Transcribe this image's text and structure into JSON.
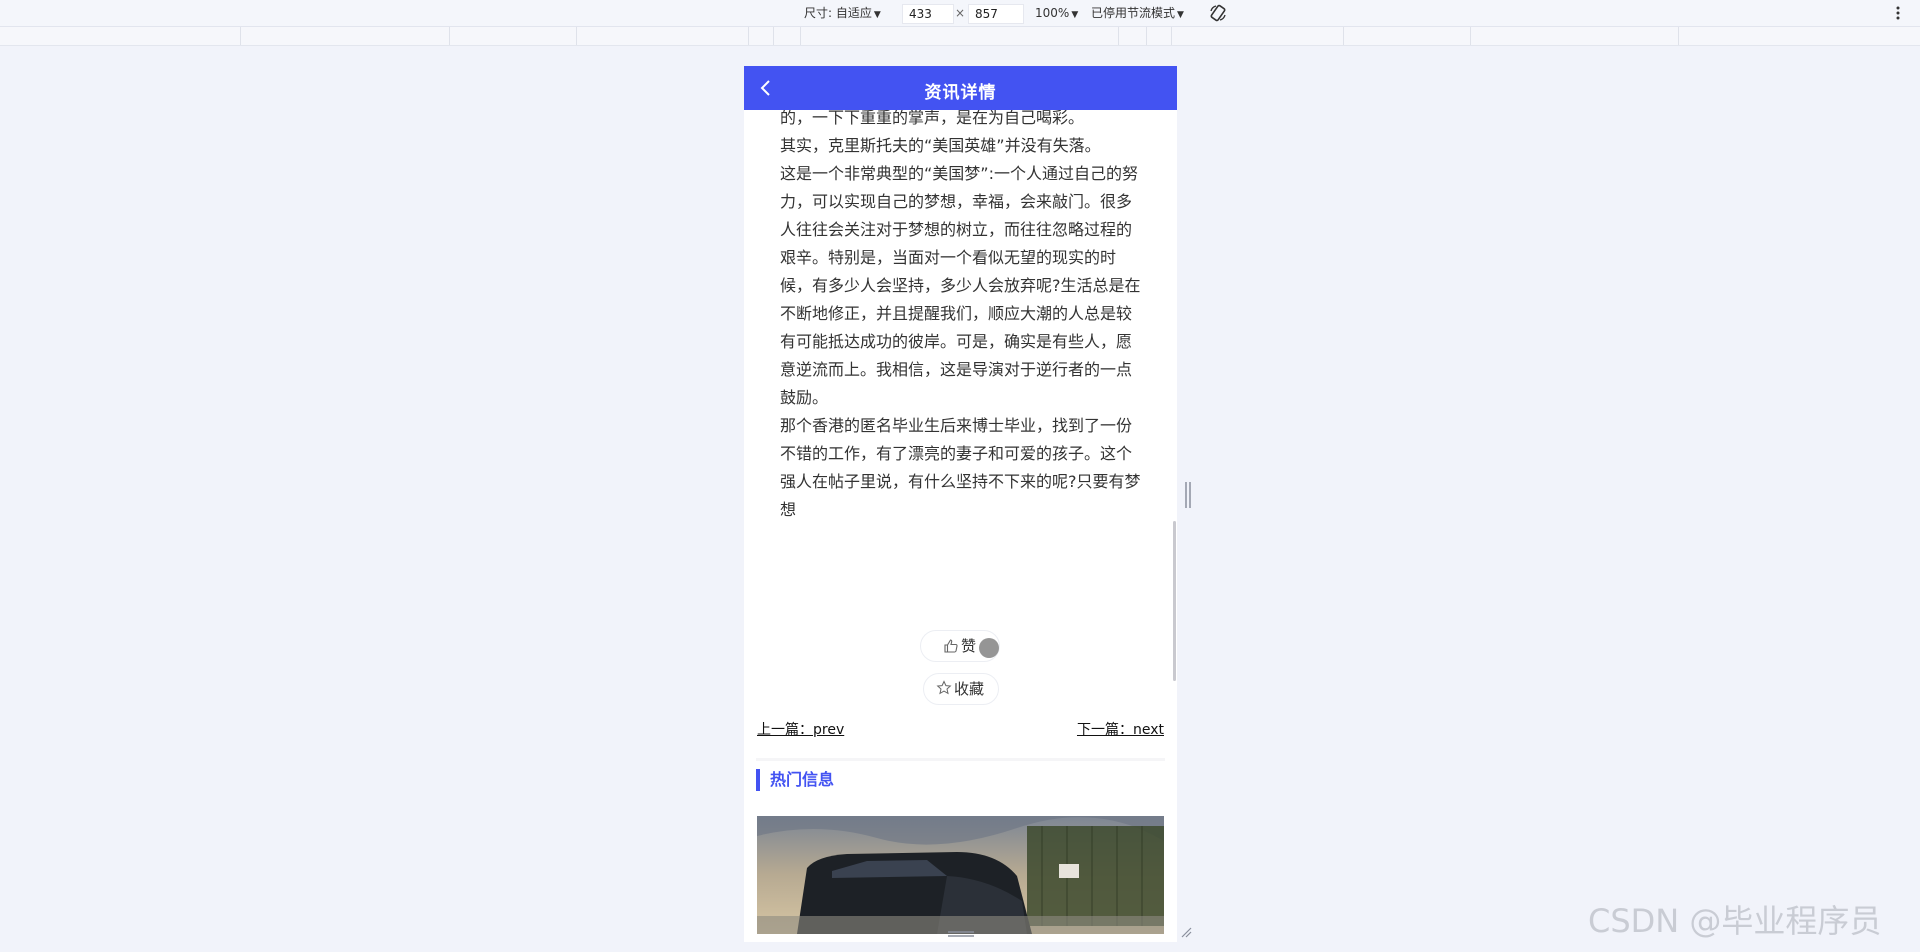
{
  "devtools": {
    "size_label": "尺寸: 自适应",
    "width_value": "433",
    "times": "×",
    "height_value": "857",
    "zoom": "100%",
    "throttle": "已停用节流模式"
  },
  "page": {
    "title": "资讯详情",
    "article_paragraphs": [
      "的，一下下重重的掌声，是在为自己喝彩。",
      "其实，克里斯托夫的“美国英雄”并没有失落。",
      "这是一个非常典型的“美国梦”:一个人通过自己的努力，可以实现自己的梦想，幸福，会来敲门。很多人往往会关注对于梦想的树立，而往往忽略过程的艰辛。特别是，当面对一个看似无望的现实的时候，有多少人会坚持，多少人会放弃呢?生活总是在不断地修正，并且提醒我们，顺应大潮的人总是较有可能抵达成功的彼岸。可是，确实是有些人，愿意逆流而上。我相信，这是导演对于逆行者的一点鼓励。",
      "那个香港的匿名毕业生后来博士毕业，找到了一份不错的工作，有了漂亮的妻子和可爱的孩子。这个强人在帖子里说，有什么坚持不下来的呢?只要有梦想"
    ],
    "like_label": "赞",
    "favorite_label": "收藏",
    "prev_label": "上一篇：prev",
    "next_label": "下一篇：next",
    "hot_title": "热门信息"
  },
  "watermark": "CSDN @毕业程序员",
  "colors": {
    "accent": "#4353f2"
  },
  "icons": [
    "chevron-left-icon",
    "thumbs-up-icon",
    "star-icon",
    "rotate-icon",
    "kebab-menu-icon"
  ]
}
